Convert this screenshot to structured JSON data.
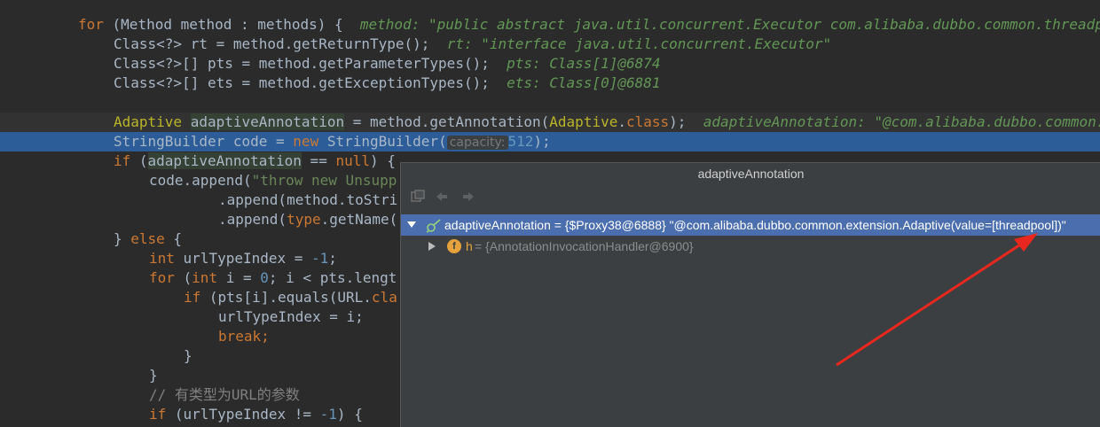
{
  "code": {
    "l1_for": "for",
    "l1_rest": " (Method method : methods) {  ",
    "l1_hint": "method: \"public abstract java.util.concurrent.Executor com.alibaba.dubbo.common.threadpool",
    "l2": "Class<?> rt = method.getReturnType();  ",
    "l2_hint": "rt: \"interface java.util.concurrent.Executor\"",
    "l3": "Class<?>[] pts = method.getParameterTypes();  ",
    "l3_hint": "pts: Class[1]@6874",
    "l4": "Class<?>[] ets = method.getExceptionTypes();  ",
    "l4_hint": "ets: Class[0]@6881",
    "l6_type": "Adaptive",
    "l6_var": "adaptiveAnnotation",
    "l6_mid": " = method.getAnnotation(",
    "l6_cls": "Adaptive",
    "l6_dot": ".",
    "l6_class": "class",
    "l6_end": ");  ",
    "l6_hint": "adaptiveAnnotation: \"@com.alibaba.dubbo.common.extension.Adaptive",
    "l7_a": "StringBuilder code = ",
    "l7_new": "new",
    "l7_b": " StringBuilder(",
    "l7_param": "capacity:",
    "l7_num": "512",
    "l7_end": ");",
    "l8_if": "if",
    "l8_a": " (",
    "l8_var": "adaptiveAnnotation",
    "l8_b": " == ",
    "l8_null": "null",
    "l8_c": ") {",
    "l9_a": "code.append(",
    "l9_str": "\"throw new Unsupp",
    "l10": ".append(method.toStri",
    "l11_a": ".append(",
    "l11_type": "type",
    "l11_b": ".getName(",
    "l12_a": "} ",
    "l12_else": "else",
    "l12_b": " {",
    "l13_int": "int",
    "l13_a": " urlTypeIndex = ",
    "l13_num": "-1",
    "l13_b": ";",
    "l14_for": "for",
    "l14_a": " (",
    "l14_int": "int",
    "l14_b": " i = ",
    "l14_num": "0",
    "l14_c": "; i < pts.lengt",
    "l15_if": "if",
    "l15_a": " (pts[i].equals(URL.",
    "l15_cla": "cla",
    "l16": "urlTypeIndex = i;",
    "l17": "break;",
    "l18": "}",
    "l19": "}",
    "l20": "// 有类型为URL的参数",
    "l21_if": "if",
    "l21_a": " (urlTypeIndex != ",
    "l21_num": "-1",
    "l21_b": ") {"
  },
  "popup": {
    "title": "adaptiveAnnotation",
    "row1": "adaptiveAnnotation = {$Proxy38@6888} \"@com.alibaba.dubbo.common.extension.Adaptive(value=[threadpool])\"",
    "row2_name": "h",
    "row2_value": " = {AnnotationInvocationHandler@6900}",
    "field_badge": "f"
  },
  "colors": {
    "background": "#2b2b2b",
    "selected_line": "#2d5d98",
    "popup_bg": "#3c3f41",
    "popup_selection": "#4b6eaf",
    "annotation_arrow": "#e8281e"
  },
  "icons": [
    "lightbulb-icon",
    "watch-icon",
    "field-icon",
    "expand-icon",
    "collapse-icon",
    "back-icon",
    "forward-icon",
    "restore-icon"
  ]
}
